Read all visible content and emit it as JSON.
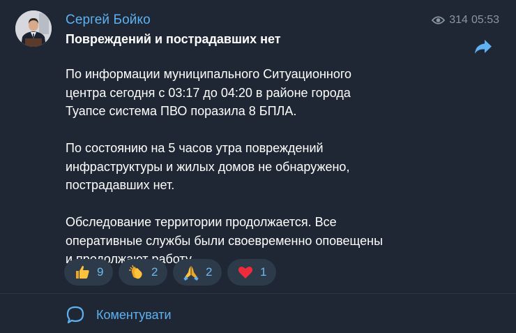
{
  "post": {
    "author": "Сергей Бойко",
    "views": "314",
    "time": "05:53",
    "title": "Повреждений и пострадавших нет",
    "paragraphs": [
      "По информации муниципального Ситуационного\nцентра сегодня с 03:17 до 04:20 в районе города\nТуапсе система ПВО поразила 8 БПЛА.",
      "По состоянию на 5 часов утра повреждений\nинфраструктуры и жилых домов не обнаружено,\nпострадавших нет.",
      "Обследование территории продолжается. Все\nоперативные службы были своевременно оповещены\nи продолжают работу."
    ]
  },
  "reactions": [
    {
      "icon": "thumbs-up-icon",
      "count": "9"
    },
    {
      "icon": "clapping-hands-icon",
      "count": "2"
    },
    {
      "icon": "folded-hands-icon",
      "count": "2"
    },
    {
      "icon": "red-heart-icon",
      "count": "1"
    }
  ],
  "footer": {
    "comment_label": "Коментувати"
  },
  "colors": {
    "background": "#1e2733",
    "accent": "#5fb1f2",
    "reaction_bg": "#2d3a49"
  }
}
